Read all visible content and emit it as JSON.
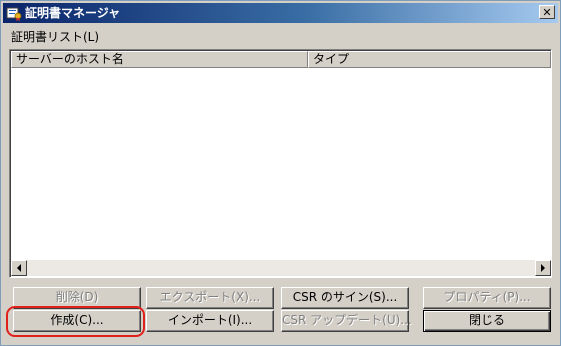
{
  "window": {
    "title": "証明書マネージャ",
    "close_glyph": "✕"
  },
  "list": {
    "label": "証明書リスト(L)",
    "columns": [
      "サーバーのホスト名",
      "タイプ"
    ],
    "rows": []
  },
  "buttons": {
    "delete": "削除(D)",
    "export": "エクスポート(X)...",
    "csr_sign": "CSR のサイン(S)...",
    "properties": "プロパティ(P)...",
    "create": "作成(C)...",
    "import": "インポート(I)...",
    "csr_update": "CSR アップデート(U)...",
    "close": "閉じる"
  },
  "colors": {
    "highlight": "#e0201a",
    "title_bar": "#0a246a"
  }
}
